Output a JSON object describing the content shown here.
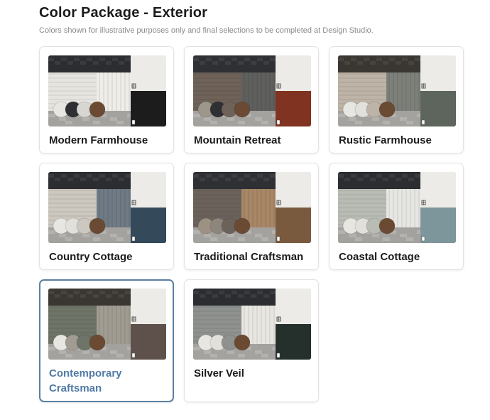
{
  "page": {
    "title": "Color Package - Exterior",
    "subtitle": "Colors shown for illustrative purposes only and final selections to be completed at Design Studio."
  },
  "accent_color": "#5a7fa3",
  "selected_index": 6,
  "packages": [
    {
      "name": "Modern Farmhouse",
      "roof": "#2b2d30",
      "siding_left": "#e6e4df",
      "siding_right": "#eeede8",
      "door": "#1c1c1d",
      "upper_right": "#ecebe7",
      "chips": [
        "#e8e6e1",
        "#2f3033",
        "#d8d6d1",
        "#6a4a33"
      ]
    },
    {
      "name": "Mountain Retreat",
      "roof": "#2e3033",
      "siding_left": "#6e6259",
      "siding_right": "#5f5f5d",
      "door": "#7f3320",
      "upper_right": "#ecebe7",
      "chips": [
        "#9c978a",
        "#2f3033",
        "#6e6259",
        "#6a4a33"
      ]
    },
    {
      "name": "Rustic Farmhouse",
      "roof": "#3a3632",
      "siding_left": "#bdb3a6",
      "siding_right": "#7d7f79",
      "door": "#5d655c",
      "upper_right": "#ecebe7",
      "chips": [
        "#e8e6e1",
        "#e2e0db",
        "#bdb3a6",
        "#6a4a33"
      ]
    },
    {
      "name": "Country Cottage",
      "roof": "#2b2d30",
      "siding_left": "#ccc7bf",
      "siding_right": "#6f7a84",
      "door": "#34495a",
      "upper_right": "#ecebe7",
      "chips": [
        "#e8e6e1",
        "#e2e0db",
        "#ccc7bf",
        "#6a4a33"
      ]
    },
    {
      "name": "Traditional Craftsman",
      "roof": "#2e3033",
      "siding_left": "#6b625c",
      "siding_right": "#a88766",
      "door": "#7a5a3e",
      "upper_right": "#ecebe7",
      "chips": [
        "#9c9182",
        "#8d867c",
        "#6b625c",
        "#6a4a33"
      ]
    },
    {
      "name": "Coastal Cottage",
      "roof": "#2b2d30",
      "siding_left": "#b9bcb5",
      "siding_right": "#e6e6e2",
      "door": "#7d969b",
      "upper_right": "#ecebe7",
      "chips": [
        "#e8e6e1",
        "#e2e0db",
        "#b9bcb5",
        "#6a4a33"
      ]
    },
    {
      "name": "Contemporary Craftsman",
      "roof": "#3a3632",
      "siding_left": "#6e7468",
      "siding_right": "#a09c91",
      "door": "#5e514c",
      "upper_right": "#ecebe7",
      "chips": [
        "#e8e6e1",
        "#a09c91",
        "#6e7468",
        "#6a4a33"
      ]
    },
    {
      "name": "Silver Veil",
      "roof": "#2b2d30",
      "siding_left": "#8e918e",
      "siding_right": "#e7e6e1",
      "door": "#25302c",
      "upper_right": "#ecebe7",
      "chips": [
        "#e8e6e1",
        "#e2e0db",
        "#8e918e",
        "#6a4a33"
      ]
    }
  ]
}
